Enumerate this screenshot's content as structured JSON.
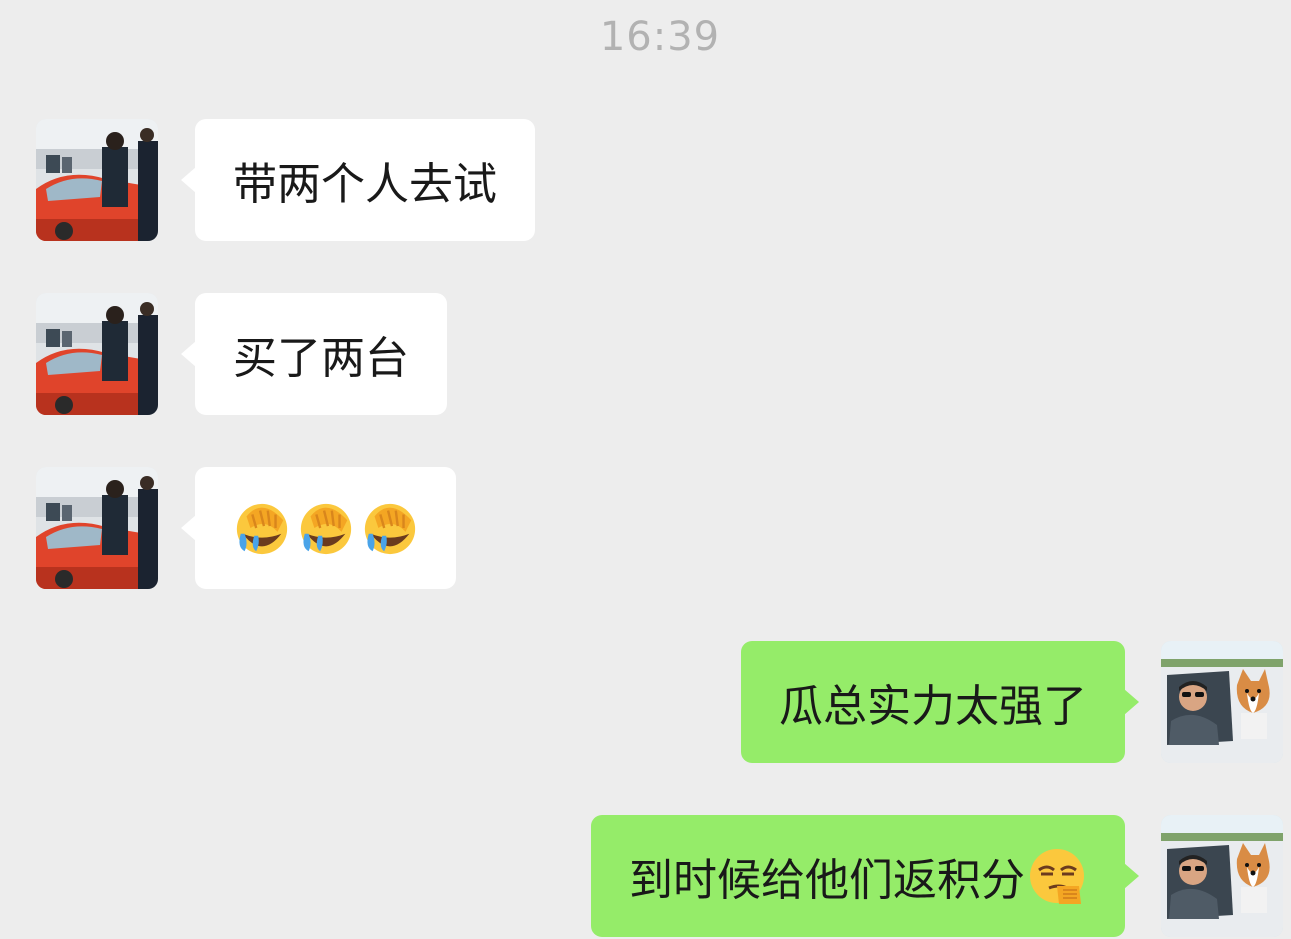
{
  "timestamp": "16:39",
  "messages": [
    {
      "side": "in",
      "text": "带两个人去试",
      "avatar": "red-car-man-avatar"
    },
    {
      "side": "in",
      "text": "买了两台",
      "avatar": "red-car-man-avatar"
    },
    {
      "side": "in",
      "text": "",
      "emoji": [
        "facepalm-crying-emoji",
        "facepalm-crying-emoji",
        "facepalm-crying-emoji"
      ],
      "avatar": "red-car-man-avatar"
    },
    {
      "side": "out",
      "text": "瓜总实力太强了",
      "avatar": "car-dog-avatar"
    },
    {
      "side": "out",
      "text": "到时候给他们返积分",
      "trailing_emoji": "smirk-emoji",
      "avatar": "car-dog-avatar"
    }
  ],
  "colors": {
    "background": "#ededed",
    "incoming_bubble": "#ffffff",
    "outgoing_bubble": "#95ec69",
    "timestamp": "#b2b2b2"
  }
}
